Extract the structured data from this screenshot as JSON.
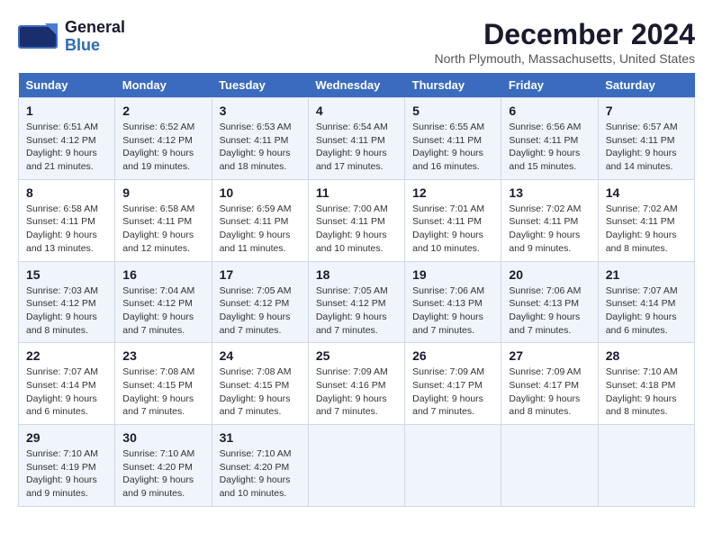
{
  "header": {
    "logo_general": "General",
    "logo_blue": "Blue",
    "main_title": "December 2024",
    "subtitle": "North Plymouth, Massachusetts, United States"
  },
  "weekdays": [
    "Sunday",
    "Monday",
    "Tuesday",
    "Wednesday",
    "Thursday",
    "Friday",
    "Saturday"
  ],
  "weeks": [
    [
      {
        "day": "1",
        "info": "Sunrise: 6:51 AM\nSunset: 4:12 PM\nDaylight: 9 hours\nand 21 minutes."
      },
      {
        "day": "2",
        "info": "Sunrise: 6:52 AM\nSunset: 4:12 PM\nDaylight: 9 hours\nand 19 minutes."
      },
      {
        "day": "3",
        "info": "Sunrise: 6:53 AM\nSunset: 4:11 PM\nDaylight: 9 hours\nand 18 minutes."
      },
      {
        "day": "4",
        "info": "Sunrise: 6:54 AM\nSunset: 4:11 PM\nDaylight: 9 hours\nand 17 minutes."
      },
      {
        "day": "5",
        "info": "Sunrise: 6:55 AM\nSunset: 4:11 PM\nDaylight: 9 hours\nand 16 minutes."
      },
      {
        "day": "6",
        "info": "Sunrise: 6:56 AM\nSunset: 4:11 PM\nDaylight: 9 hours\nand 15 minutes."
      },
      {
        "day": "7",
        "info": "Sunrise: 6:57 AM\nSunset: 4:11 PM\nDaylight: 9 hours\nand 14 minutes."
      }
    ],
    [
      {
        "day": "8",
        "info": "Sunrise: 6:58 AM\nSunset: 4:11 PM\nDaylight: 9 hours\nand 13 minutes."
      },
      {
        "day": "9",
        "info": "Sunrise: 6:58 AM\nSunset: 4:11 PM\nDaylight: 9 hours\nand 12 minutes."
      },
      {
        "day": "10",
        "info": "Sunrise: 6:59 AM\nSunset: 4:11 PM\nDaylight: 9 hours\nand 11 minutes."
      },
      {
        "day": "11",
        "info": "Sunrise: 7:00 AM\nSunset: 4:11 PM\nDaylight: 9 hours\nand 10 minutes."
      },
      {
        "day": "12",
        "info": "Sunrise: 7:01 AM\nSunset: 4:11 PM\nDaylight: 9 hours\nand 10 minutes."
      },
      {
        "day": "13",
        "info": "Sunrise: 7:02 AM\nSunset: 4:11 PM\nDaylight: 9 hours\nand 9 minutes."
      },
      {
        "day": "14",
        "info": "Sunrise: 7:02 AM\nSunset: 4:11 PM\nDaylight: 9 hours\nand 8 minutes."
      }
    ],
    [
      {
        "day": "15",
        "info": "Sunrise: 7:03 AM\nSunset: 4:12 PM\nDaylight: 9 hours\nand 8 minutes."
      },
      {
        "day": "16",
        "info": "Sunrise: 7:04 AM\nSunset: 4:12 PM\nDaylight: 9 hours\nand 7 minutes."
      },
      {
        "day": "17",
        "info": "Sunrise: 7:05 AM\nSunset: 4:12 PM\nDaylight: 9 hours\nand 7 minutes."
      },
      {
        "day": "18",
        "info": "Sunrise: 7:05 AM\nSunset: 4:12 PM\nDaylight: 9 hours\nand 7 minutes."
      },
      {
        "day": "19",
        "info": "Sunrise: 7:06 AM\nSunset: 4:13 PM\nDaylight: 9 hours\nand 7 minutes."
      },
      {
        "day": "20",
        "info": "Sunrise: 7:06 AM\nSunset: 4:13 PM\nDaylight: 9 hours\nand 7 minutes."
      },
      {
        "day": "21",
        "info": "Sunrise: 7:07 AM\nSunset: 4:14 PM\nDaylight: 9 hours\nand 6 minutes."
      }
    ],
    [
      {
        "day": "22",
        "info": "Sunrise: 7:07 AM\nSunset: 4:14 PM\nDaylight: 9 hours\nand 6 minutes."
      },
      {
        "day": "23",
        "info": "Sunrise: 7:08 AM\nSunset: 4:15 PM\nDaylight: 9 hours\nand 7 minutes."
      },
      {
        "day": "24",
        "info": "Sunrise: 7:08 AM\nSunset: 4:15 PM\nDaylight: 9 hours\nand 7 minutes."
      },
      {
        "day": "25",
        "info": "Sunrise: 7:09 AM\nSunset: 4:16 PM\nDaylight: 9 hours\nand 7 minutes."
      },
      {
        "day": "26",
        "info": "Sunrise: 7:09 AM\nSunset: 4:17 PM\nDaylight: 9 hours\nand 7 minutes."
      },
      {
        "day": "27",
        "info": "Sunrise: 7:09 AM\nSunset: 4:17 PM\nDaylight: 9 hours\nand 8 minutes."
      },
      {
        "day": "28",
        "info": "Sunrise: 7:10 AM\nSunset: 4:18 PM\nDaylight: 9 hours\nand 8 minutes."
      }
    ],
    [
      {
        "day": "29",
        "info": "Sunrise: 7:10 AM\nSunset: 4:19 PM\nDaylight: 9 hours\nand 9 minutes."
      },
      {
        "day": "30",
        "info": "Sunrise: 7:10 AM\nSunset: 4:20 PM\nDaylight: 9 hours\nand 9 minutes."
      },
      {
        "day": "31",
        "info": "Sunrise: 7:10 AM\nSunset: 4:20 PM\nDaylight: 9 hours\nand 10 minutes."
      },
      null,
      null,
      null,
      null
    ]
  ]
}
